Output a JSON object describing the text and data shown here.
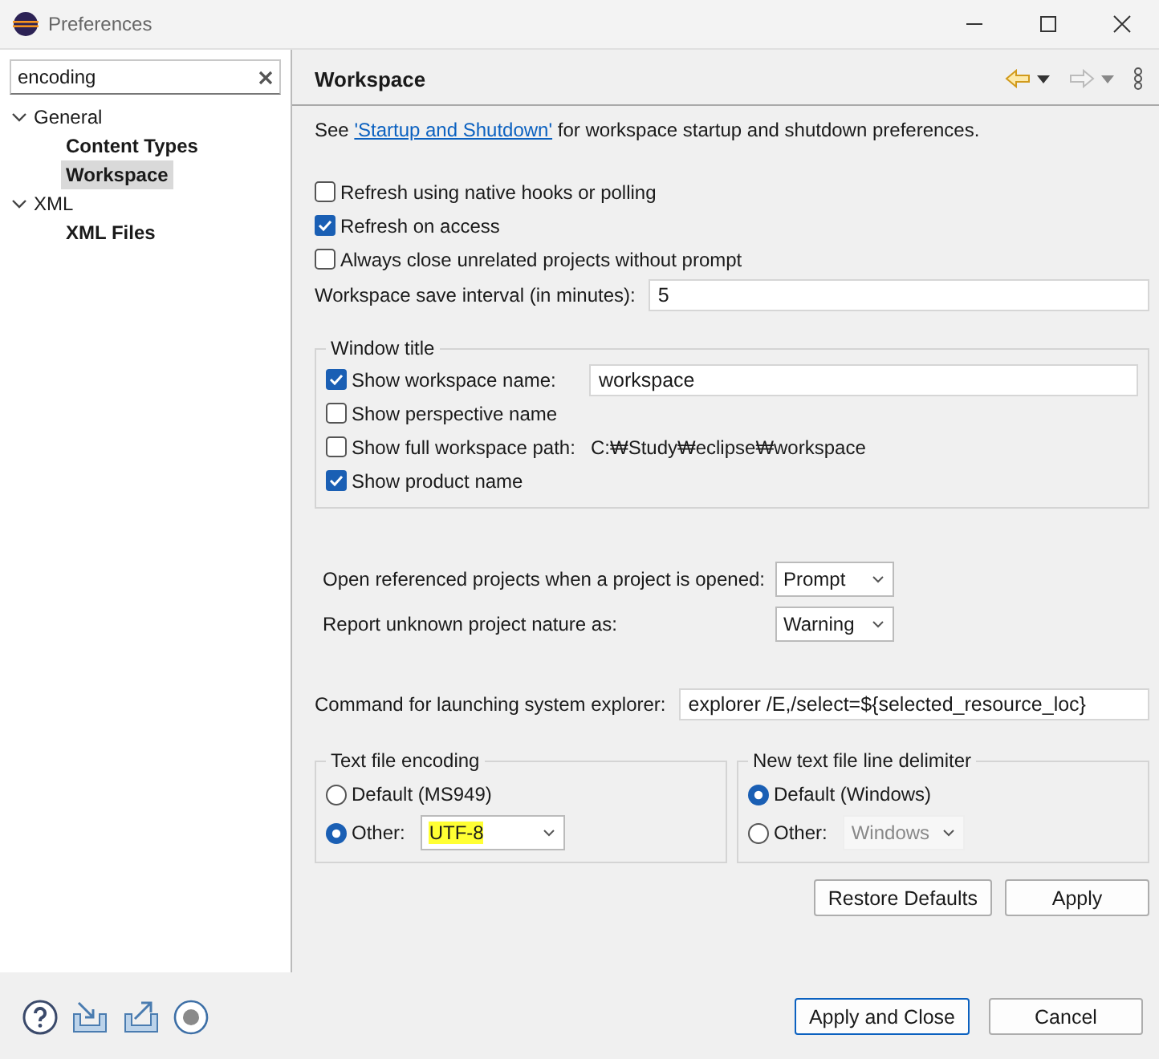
{
  "window": {
    "title": "Preferences"
  },
  "filter": {
    "value": "encoding"
  },
  "tree": [
    {
      "label": "General",
      "expanded": true,
      "children": [
        {
          "label": "Content Types",
          "selected": false
        },
        {
          "label": "Workspace",
          "selected": true
        }
      ]
    },
    {
      "label": "XML",
      "expanded": true,
      "children": [
        {
          "label": "XML Files",
          "selected": false
        }
      ]
    }
  ],
  "page": {
    "title": "Workspace",
    "intro_before": "See ",
    "intro_link": "'Startup and Shutdown'",
    "intro_after": " for workspace startup and shutdown preferences."
  },
  "options": [
    {
      "label": "Refresh using native hooks or polling",
      "checked": false
    },
    {
      "label": "Refresh on access",
      "checked": true
    },
    {
      "label": "Always close unrelated projects without prompt",
      "checked": false
    }
  ],
  "save_interval": {
    "label": "Workspace save interval (in minutes):",
    "value": "5"
  },
  "window_title": {
    "title": "Window title",
    "items": [
      {
        "kind": "field",
        "label": "Show workspace name:",
        "checked": true,
        "value": "workspace"
      },
      {
        "kind": "plain",
        "label": "Show perspective name",
        "checked": false
      },
      {
        "kind": "path",
        "label": "Show full workspace path:",
        "checked": false,
        "value": "C:₩Study₩eclipse₩workspace"
      },
      {
        "kind": "plain",
        "label": "Show product name",
        "checked": true
      }
    ]
  },
  "selects": [
    {
      "label": "Open referenced projects when a project is opened:",
      "value": "Prompt"
    },
    {
      "label": "Report unknown project nature as:",
      "value": "Warning"
    }
  ],
  "explorer_command": {
    "label": "Command for launching system explorer:",
    "value": "explorer /E,/select=${selected_resource_loc}"
  },
  "encoding": {
    "title": "Text file encoding",
    "options": [
      {
        "label": "Default (MS949)",
        "selected": false
      },
      {
        "label": "Other:",
        "selected": true,
        "value": "UTF-8",
        "highlighted": true
      }
    ]
  },
  "delimiter": {
    "title": "New text file line delimiter",
    "options": [
      {
        "label": "Default (Windows)",
        "selected": true
      },
      {
        "label": "Other:",
        "selected": false,
        "value": "Windows",
        "highlighted": false
      }
    ]
  },
  "page_buttons": [
    "Restore Defaults",
    "Apply"
  ],
  "footer_buttons": [
    "Apply and Close",
    "Cancel"
  ]
}
